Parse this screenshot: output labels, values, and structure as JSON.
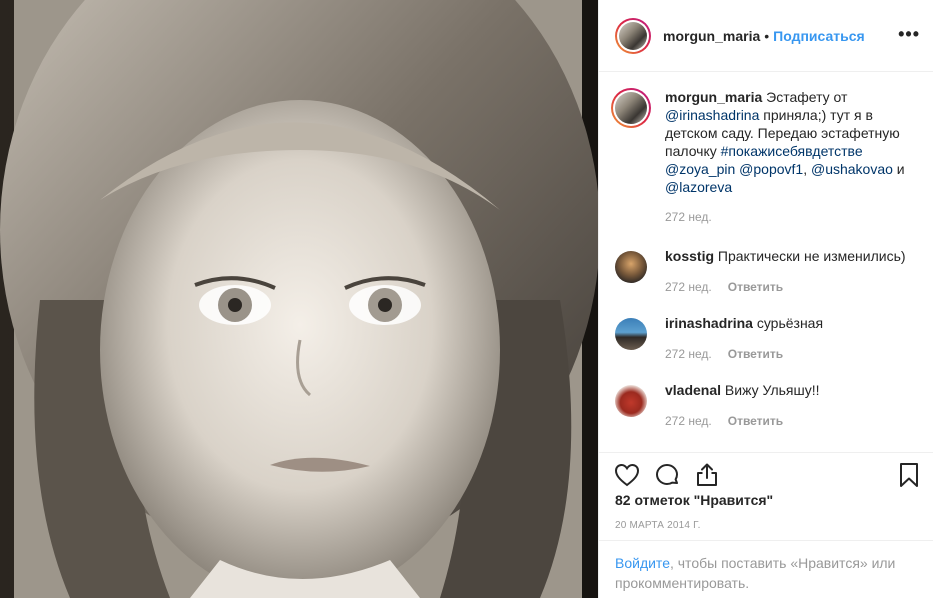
{
  "header": {
    "username": "morgun_maria",
    "separator": "•",
    "follow_label": "Подписаться",
    "more_label": "•••"
  },
  "caption": {
    "username": "morgun_maria",
    "text_before": " Эстафету от ",
    "mention1": "@irinashadrina",
    "text_mid": " приняла;) тут я в детском саду. Передаю эстафетную палочку ",
    "hashtag": "#покажисебявдетстве",
    "mention2": "@zoya_pin",
    "mention3": "@popovf1",
    "comma": ",",
    "mention4": "@ushakovao",
    "and": " и ",
    "mention5": "@lazoreva",
    "time": "272 нед."
  },
  "comments": [
    {
      "username": "kosstig",
      "text": "Практически не изменились)",
      "time": "272 нед.",
      "reply": "Ответить"
    },
    {
      "username": "irinashadrina",
      "text": "сурьёзная",
      "time": "272 нед.",
      "reply": "Ответить"
    },
    {
      "username": "vladenal",
      "text": "Вижу Ульяшу!!",
      "time": "272 нед.",
      "reply": "Ответить"
    }
  ],
  "icons": [
    "heart-icon",
    "comment-icon",
    "share-icon",
    "bookmark-icon"
  ],
  "likes": "82 отметок \"Нравится\"",
  "date": "20 МАРТА 2014 Г.",
  "login": {
    "link": "Войдите",
    "text": ", чтобы поставить «Нравится» или прокомментировать."
  },
  "colors": {
    "accent": "#3897f0",
    "link": "#003569",
    "muted": "#999999"
  }
}
